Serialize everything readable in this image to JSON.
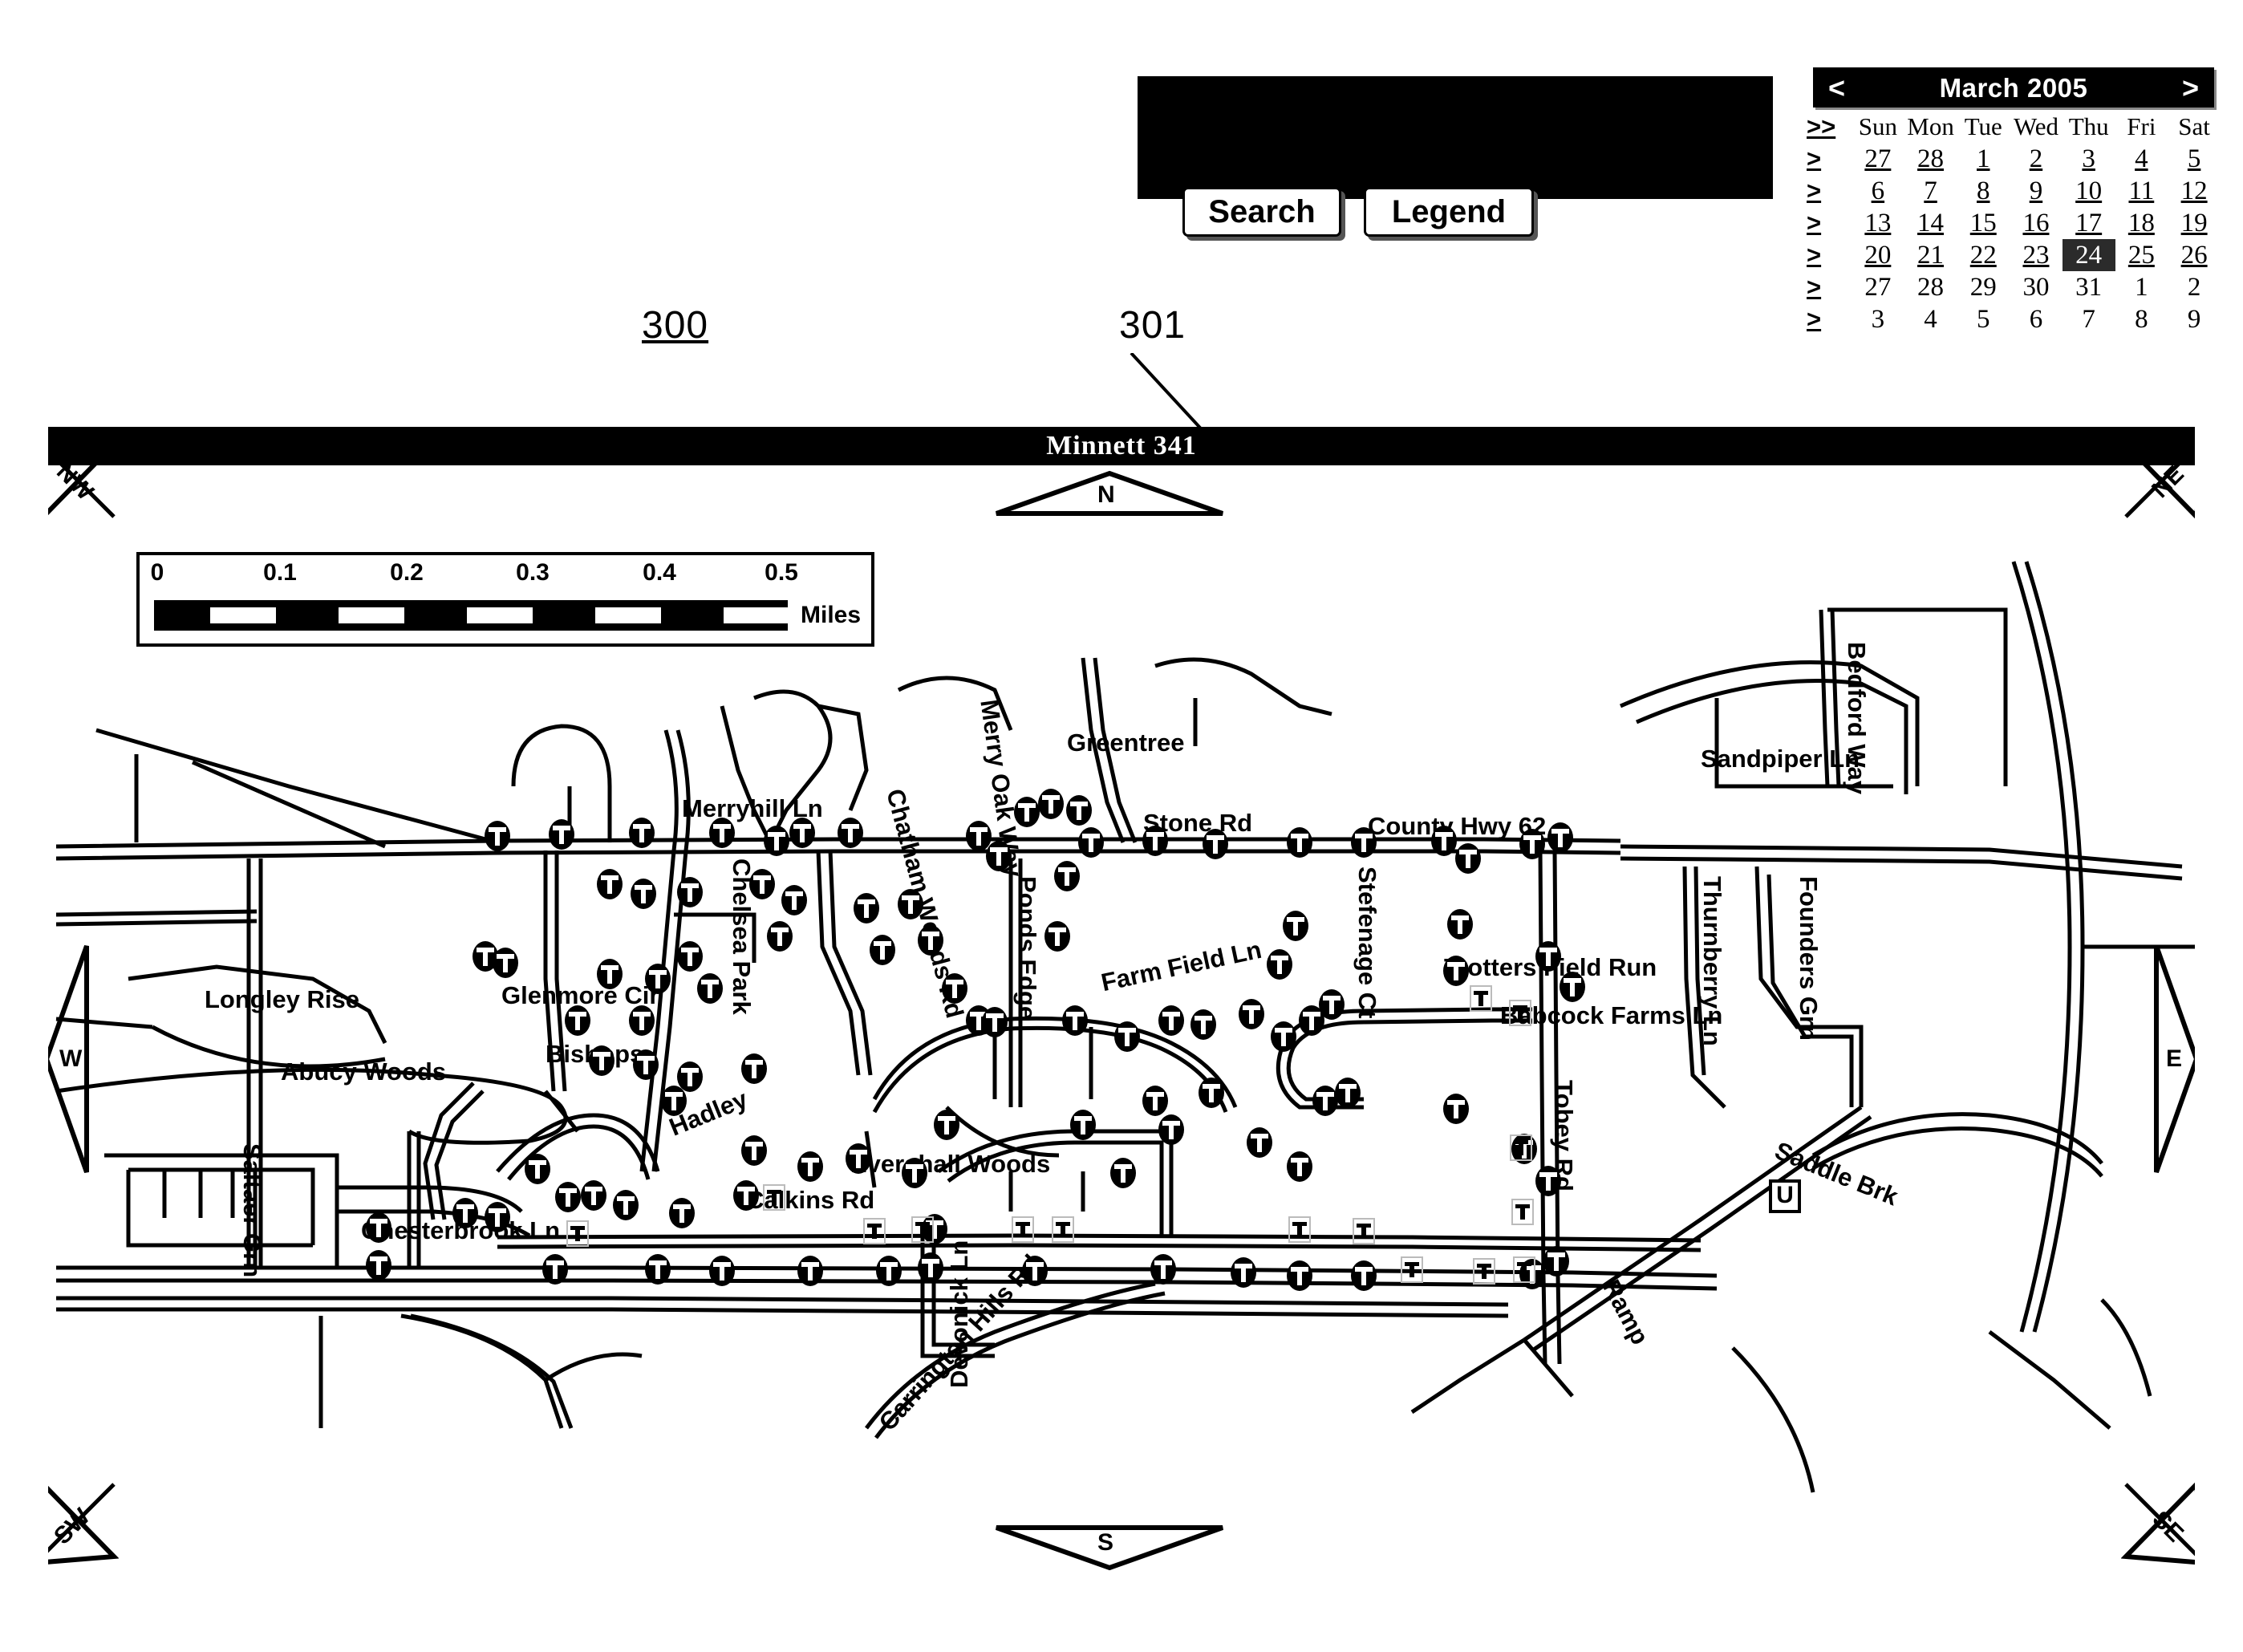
{
  "toolbar": {
    "search_label": "Search",
    "legend_label": "Legend",
    "background_color": "#000000"
  },
  "calendar": {
    "title": "March 2005",
    "prev_label": "<",
    "next_label": ">",
    "week_all_label": ">>",
    "week_row_label": ">",
    "day_names": [
      "Sun",
      "Mon",
      "Tue",
      "Wed",
      "Thu",
      "Fri",
      "Sat"
    ],
    "selected_day": "24",
    "weeks": [
      {
        "days": [
          "27",
          "28",
          "1",
          "2",
          "3",
          "4",
          "5"
        ],
        "linked": true
      },
      {
        "days": [
          "6",
          "7",
          "8",
          "9",
          "10",
          "11",
          "12"
        ],
        "linked": true
      },
      {
        "days": [
          "13",
          "14",
          "15",
          "16",
          "17",
          "18",
          "19"
        ],
        "linked": true
      },
      {
        "days": [
          "20",
          "21",
          "22",
          "23",
          "24",
          "25",
          "26"
        ],
        "linked": true
      },
      {
        "days": [
          "27",
          "28",
          "29",
          "30",
          "31",
          "1",
          "2"
        ],
        "linked": false
      },
      {
        "days": [
          "3",
          "4",
          "5",
          "6",
          "7",
          "8",
          "9"
        ],
        "linked": false
      }
    ]
  },
  "figure_refs": [
    {
      "id": "300",
      "underlined": true
    },
    {
      "id": "301",
      "underlined": false
    }
  ],
  "map": {
    "title": "Minnett 341",
    "scale": {
      "ticks": [
        "0",
        "0.1",
        "0.2",
        "0.3",
        "0.4",
        "0.5"
      ],
      "unit": "Miles"
    },
    "compass": {
      "nw": "NW",
      "ne": "NE",
      "sw": "SW",
      "se": "SE",
      "n": "N",
      "s": "S",
      "e": "E",
      "w": "W"
    },
    "badges": [
      "U"
    ],
    "street_labels": [
      "Merryhill Ln",
      "Chatham Woods Rd",
      "Merry Oak Way",
      "Greentree",
      "Stone Rd",
      "Ponds Edge",
      "County Hwy 62",
      "Sandpiper Ln",
      "Bedford Way",
      "Thurnberry Ln",
      "Founders Grn",
      "Stefenage Ct",
      "Trotters Field Run",
      "Babcock Farms Ln",
      "Farm Field Ln",
      "Chelsea Park",
      "Longley Rise",
      "Glenmore Cir",
      "Abucy Woods",
      "Bishops",
      "Saltaer Grn",
      "Hadley",
      "Evershall Woods",
      "Calkins Rd",
      "Chesterbrook Ln",
      "Carrington Hills Rd",
      "Devonick Ln",
      "Tobey Rd",
      "Saddle Brk",
      "Ramp"
    ]
  }
}
